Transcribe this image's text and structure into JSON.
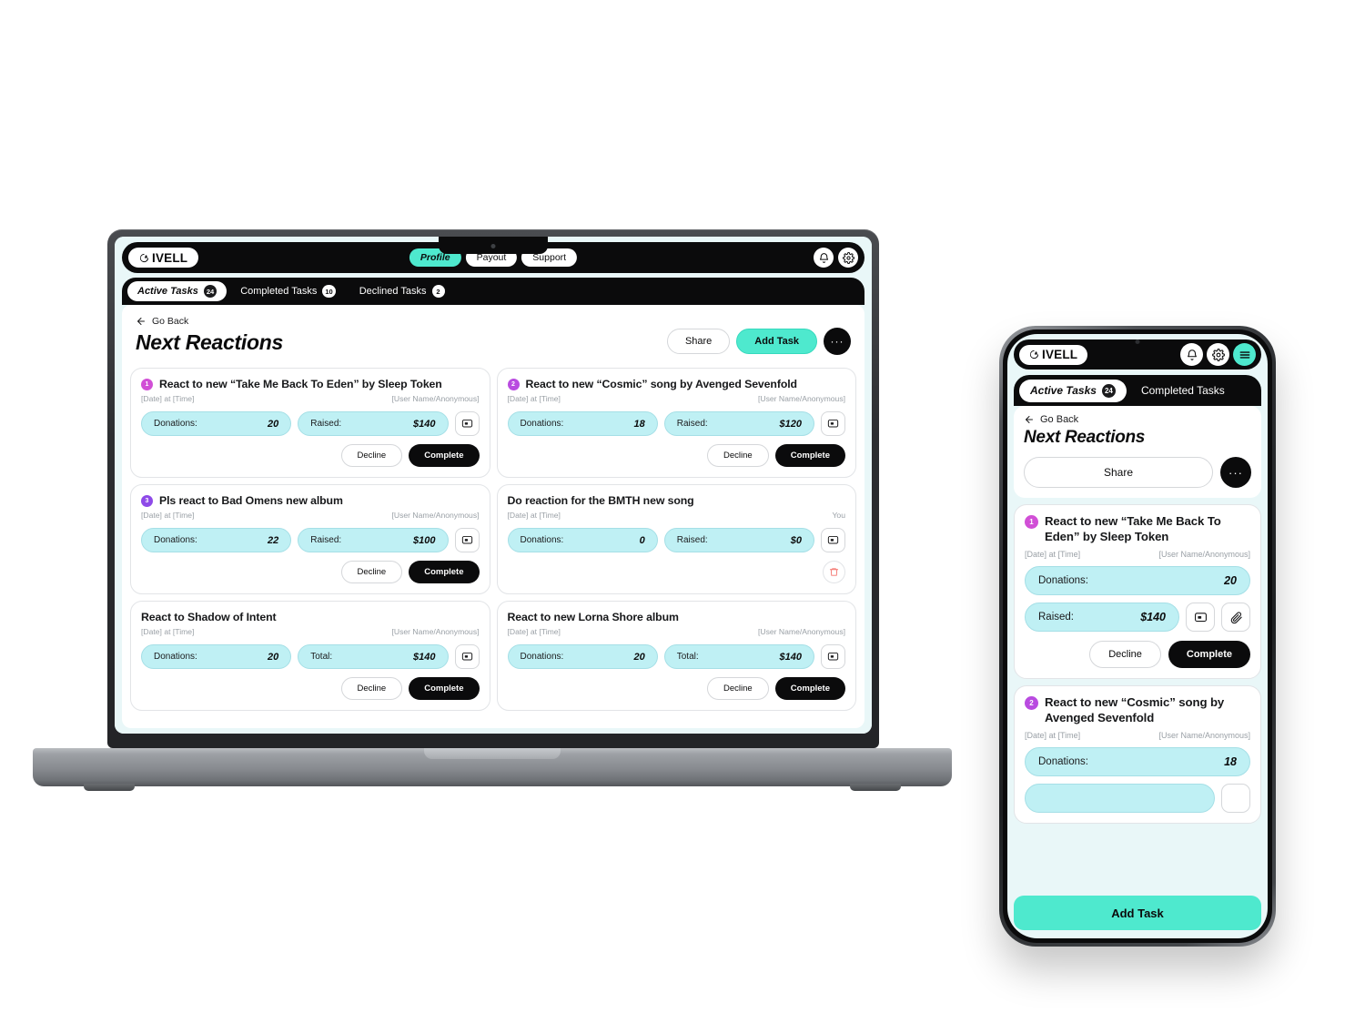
{
  "brand": {
    "name": "IVELL",
    "logo_icon": "givell-logo-icon",
    "accent": "#4EE9CE",
    "pill_bg": "#bff0f4",
    "dark": "#0b0b0c"
  },
  "desktop": {
    "topnav": [
      {
        "label": "Profile",
        "active": true
      },
      {
        "label": "Payout",
        "active": false
      },
      {
        "label": "Support",
        "active": false
      }
    ],
    "icons": {
      "bell": "bell-icon",
      "gear": "gear-icon"
    },
    "tabs": [
      {
        "label": "Active Tasks",
        "count": "24",
        "active": true
      },
      {
        "label": "Completed Tasks",
        "count": "10",
        "active": false
      },
      {
        "label": "Declined Tasks",
        "count": "2",
        "active": false
      }
    ],
    "page": {
      "go_back": "Go Back",
      "title": "Next Reactions",
      "share_label": "Share",
      "add_task_label": "Add Task",
      "more_label": "···"
    },
    "cards": [
      {
        "badge": "1",
        "badge_color": "#d14fd6",
        "title": "React to new “Take Me Back To Eden” by Sleep Token",
        "date": "[Date] at [Time]",
        "user": "[User Name/Anonymous]",
        "metric1_label": "Donations:",
        "metric1_value": "20",
        "metric2_label": "Raised:",
        "metric2_value": "$140",
        "message_icon": "message-icon",
        "decline_label": "Decline",
        "complete_label": "Complete",
        "has_trash": false
      },
      {
        "badge": "2",
        "badge_color": "#b94be0",
        "title": "React to new “Cosmic” song by Avenged Sevenfold",
        "date": "[Date] at [Time]",
        "user": "[User Name/Anonymous]",
        "metric1_label": "Donations:",
        "metric1_value": "18",
        "metric2_label": "Raised:",
        "metric2_value": "$120",
        "message_icon": "message-icon",
        "decline_label": "Decline",
        "complete_label": "Complete",
        "has_trash": false
      },
      {
        "badge": "3",
        "badge_color": "#8e4ae8",
        "title": "Pls react to Bad Omens new album",
        "date": "[Date] at [Time]",
        "user": "[User Name/Anonymous]",
        "metric1_label": "Donations:",
        "metric1_value": "22",
        "metric2_label": "Raised:",
        "metric2_value": "$100",
        "message_icon": "message-icon",
        "decline_label": "Decline",
        "complete_label": "Complete",
        "has_trash": false
      },
      {
        "badge": "",
        "badge_color": "",
        "title": "Do reaction for the BMTH new song",
        "date": "[Date] at [Time]",
        "user": "You",
        "metric1_label": "Donations:",
        "metric1_value": "0",
        "metric2_label": "Raised:",
        "metric2_value": "$0",
        "message_icon": "message-icon",
        "decline_label": "",
        "complete_label": "",
        "has_trash": true
      },
      {
        "badge": "",
        "badge_color": "",
        "title": "React to Shadow of Intent",
        "date": "[Date] at [Time]",
        "user": "[User Name/Anonymous]",
        "metric1_label": "Donations:",
        "metric1_value": "20",
        "metric2_label": "Total:",
        "metric2_value": "$140",
        "message_icon": "message-icon",
        "decline_label": "Decline",
        "complete_label": "Complete",
        "has_trash": false
      },
      {
        "badge": "",
        "badge_color": "",
        "title": "React to new Lorna Shore album",
        "date": "[Date] at [Time]",
        "user": "[User Name/Anonymous]",
        "metric1_label": "Donations:",
        "metric1_value": "20",
        "metric2_label": "Total:",
        "metric2_value": "$140",
        "message_icon": "message-icon",
        "decline_label": "Decline",
        "complete_label": "Complete",
        "has_trash": false
      }
    ]
  },
  "mobile": {
    "icons": {
      "bell": "bell-icon",
      "gear": "gear-icon",
      "menu": "hamburger-menu-icon"
    },
    "tabs": [
      {
        "label": "Active Tasks",
        "count": "24",
        "active": true
      },
      {
        "label": "Completed Tasks",
        "count": "",
        "active": false
      }
    ],
    "page": {
      "go_back": "Go Back",
      "title": "Next Reactions",
      "share_label": "Share",
      "more_label": "···",
      "add_task_label": "Add Task"
    },
    "cards": [
      {
        "badge": "1",
        "badge_color": "#d14fd6",
        "title": "React to new “Take Me Back To Eden” by Sleep Token",
        "date": "[Date] at [Time]",
        "user": "[User Name/Anonymous]",
        "metric1_label": "Donations:",
        "metric1_value": "20",
        "metric2_label": "Raised:",
        "metric2_value": "$140",
        "message_icon": "message-icon",
        "attach_icon": "paperclip-icon",
        "decline_label": "Decline",
        "complete_label": "Complete"
      },
      {
        "badge": "2",
        "badge_color": "#b94be0",
        "title": "React to new “Cosmic” song by Avenged Sevenfold",
        "date": "[Date] at [Time]",
        "user": "[User Name/Anonymous]",
        "metric1_label": "Donations:",
        "metric1_value": "18"
      }
    ]
  }
}
